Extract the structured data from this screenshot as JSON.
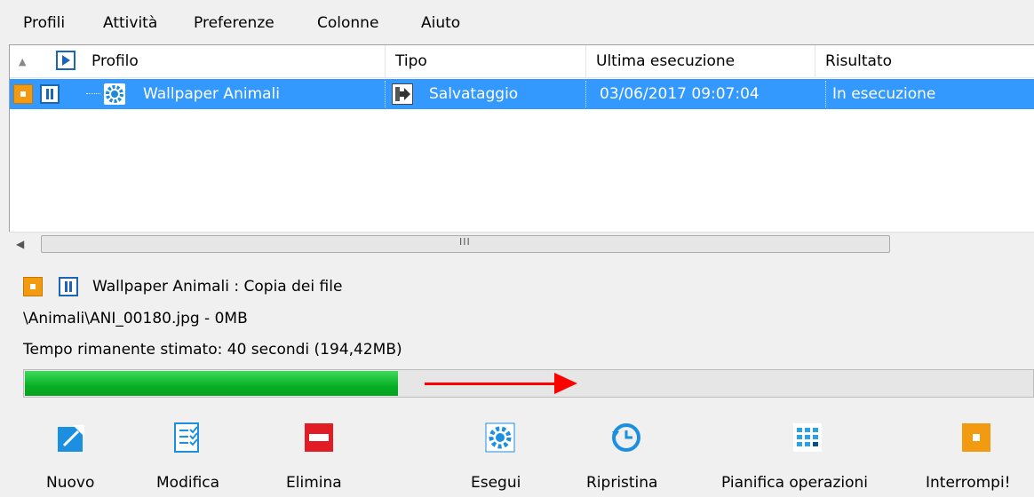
{
  "menu": {
    "items": [
      "Profili",
      "Attività",
      "Preferenze",
      "Colonne",
      "Aiuto"
    ]
  },
  "list": {
    "columns": [
      "Profilo",
      "Tipo",
      "Ultima esecuzione",
      "Risultato"
    ],
    "row": {
      "profile": "Wallpaper Animali",
      "type": "Salvataggio",
      "last_run": "03/06/2017 09:07:04",
      "result": "In esecuzione"
    }
  },
  "status": {
    "title": "Wallpaper Animali : Copia dei file",
    "file": "\\Animali\\ANI_00180.jpg - 0MB",
    "remaining": "Tempo rimanente stimato: 40 secondi (194,42MB)",
    "progress_fraction": 0.37
  },
  "toolbar": {
    "new": "Nuovo",
    "edit": "Modifica",
    "delete": "Elimina",
    "run": "Esegui",
    "restore": "Ripristina",
    "schedule": "Pianifica operazioni",
    "stop": "Interrompi!"
  },
  "colors": {
    "selection": "#3399ff",
    "progress": "#06b025",
    "annotation_arrow": "#ff0000",
    "stop_orange": "#f29b10",
    "icon_blue": "#1c64b4"
  }
}
